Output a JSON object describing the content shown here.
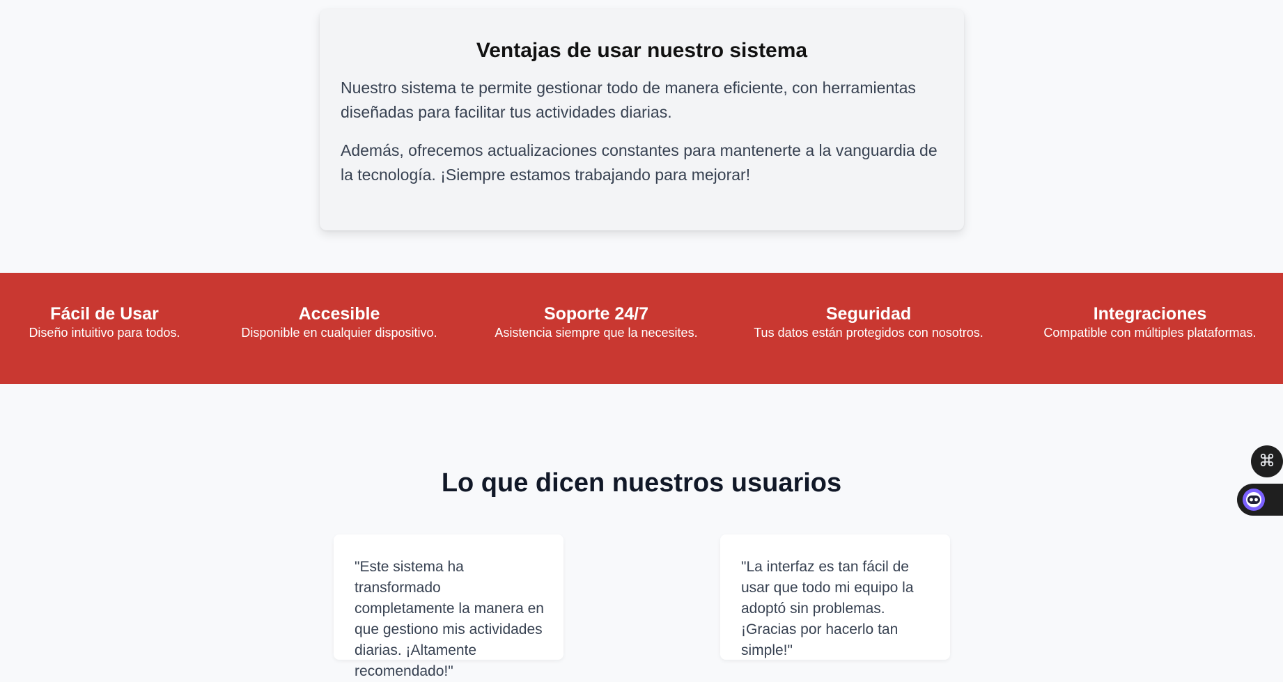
{
  "advantages": {
    "title": "Ventajas de usar nuestro sistema",
    "paragraph_1": "Nuestro sistema te permite gestionar todo de manera eficiente, con herramientas diseñadas para facilitar tus actividades diarias.",
    "paragraph_2": "Además, ofrecemos actualizaciones constantes para mantenerte a la vanguardia de la tecnología. ¡Siempre estamos trabajando para mejorar!"
  },
  "features": [
    {
      "title": "Fácil de Usar",
      "description": "Diseño intuitivo para todos."
    },
    {
      "title": "Accesible",
      "description": "Disponible en cualquier dispositivo."
    },
    {
      "title": "Soporte 24/7",
      "description": "Asistencia siempre que la necesites."
    },
    {
      "title": "Seguridad",
      "description": "Tus datos están protegidos con nosotros."
    },
    {
      "title": "Integraciones",
      "description": "Compatible con múltiples plataformas."
    }
  ],
  "testimonials": {
    "title": "Lo que dicen nuestros usuarios",
    "items": [
      {
        "quote": "\"Este sistema ha transformado completamente la manera en que gestiono mis actividades diarias. ¡Altamente recomendado!\""
      },
      {
        "quote": "\"La interfaz es tan fácil de usar que todo mi equipo la adoptó sin problemas. ¡Gracias por hacerlo tan simple!\""
      }
    ]
  },
  "colors": {
    "band_red": "#c93831",
    "page_bg": "#f8f9fb",
    "card_bg": "#f3f4f6"
  },
  "floating_widgets": {
    "icons": [
      "command-icon",
      "assistant-bot-icon"
    ]
  }
}
